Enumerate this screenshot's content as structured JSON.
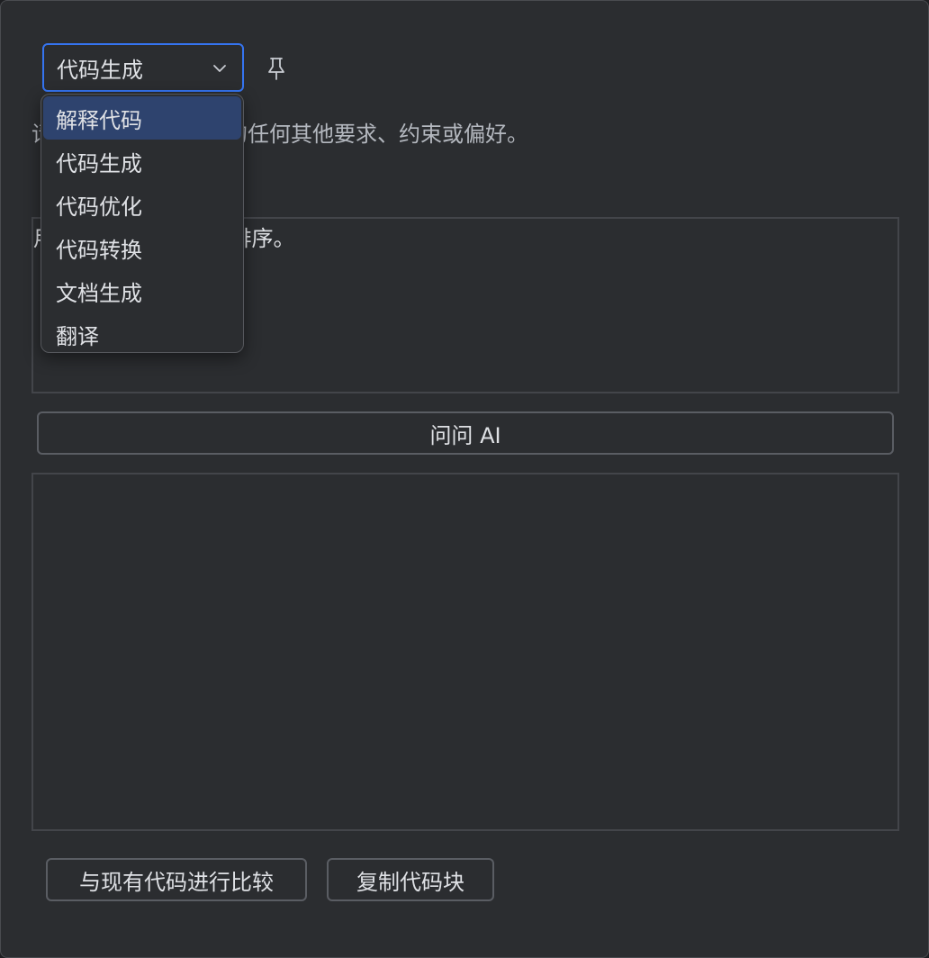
{
  "mode_select": {
    "value": "代码生成",
    "options": [
      "解释代码",
      "代码生成",
      "代码优化",
      "代码转换",
      "文档生成",
      "翻译"
    ],
    "highlighted_index": 0
  },
  "description": "请输入您对生成代码的任何其他要求、约束或偏好。",
  "prompt": {
    "value": "用 Python 实现快速排序。"
  },
  "ask_button": "问问 AI",
  "actions": {
    "compare": "与现有代码进行比较",
    "copy": "复制代码块"
  },
  "icons": {
    "select_chevron": "chevron-down-icon",
    "pin": "pin-icon"
  },
  "colors": {
    "background": "#2b2d30",
    "focus_border": "#3574f0",
    "selected_item": "#2e436e",
    "text": "#dfe1e5"
  }
}
